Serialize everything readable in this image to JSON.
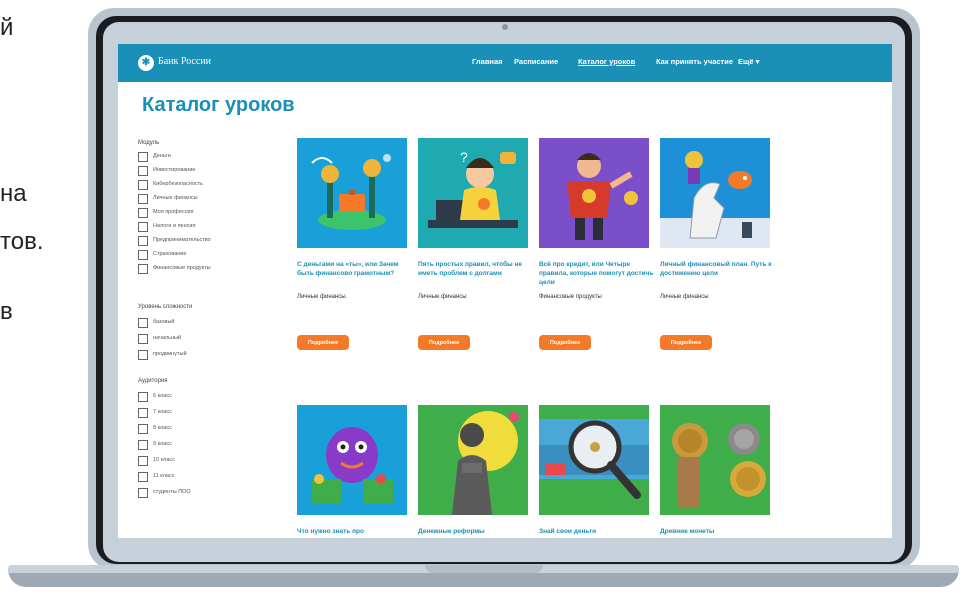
{
  "slide_fragments": [
    "й",
    "на",
    "тов.",
    "в"
  ],
  "brand": {
    "name": "Банк России"
  },
  "nav": {
    "items": [
      {
        "label": "Главная"
      },
      {
        "label": "Расписание"
      },
      {
        "label": "Каталог уроков",
        "active": true
      },
      {
        "label": "Как принять участие"
      },
      {
        "label": "Ещё ▾"
      }
    ]
  },
  "page": {
    "title": "Каталог уроков"
  },
  "filters": {
    "module": {
      "title": "Модуль",
      "options": [
        "Деньги",
        "Инвестирование",
        "Кибербезопасность",
        "Личные финансы",
        "Моя профессия",
        "Налоги и пенсия",
        "Предпринимательство",
        "Страхование",
        "Финансовые продукты"
      ]
    },
    "level": {
      "title": "Уровень сложности",
      "options": [
        "базовый",
        "начальный",
        "продвинутый"
      ]
    },
    "audience": {
      "title": "Аудитория",
      "options": [
        "6 класс",
        "7 класс",
        "8 класс",
        "9 класс",
        "10 класс",
        "11 класс",
        "студенты ПОО"
      ]
    }
  },
  "cards": [
    {
      "title": "С деньгами на «ты», или Зачем быть финансово грамотным?",
      "tag": "Личные финансы.",
      "button": "Подробнее",
      "bg": "#1aa0d8",
      "icon": "money-plant-illustration"
    },
    {
      "title": "Пять простых правил, чтобы не иметь проблем с долгами",
      "tag": "Личные финансы",
      "button": "Подробнее",
      "bg": "#1fa9b0",
      "icon": "boy-laptop-illustration"
    },
    {
      "title": "Всё про кредит, или Четыре правила, которые помогут достичь цели",
      "tag": "Финансовые продукты",
      "button": "Подробнее",
      "bg": "#7b4fc9",
      "icon": "superhero-illustration"
    },
    {
      "title": "Личный финансовый план. Путь к достижению цели",
      "tag": "Личные финансы",
      "button": "Подробнее",
      "bg": "#1e90d8",
      "icon": "chess-horse-illustration"
    },
    {
      "title": "Что нужно знать про",
      "tag": "",
      "button": "",
      "bg": "#1aa0d8",
      "icon": "purple-monster-illustration"
    },
    {
      "title": "Денежные реформы",
      "tag": "",
      "button": "",
      "bg": "#3fae4a",
      "icon": "statue-illustration"
    },
    {
      "title": "Знай свои деньги",
      "tag": "",
      "button": "",
      "bg": "#3fae4a",
      "icon": "magnifier-banknote-illustration"
    },
    {
      "title": "Древние монеты",
      "tag": "",
      "button": "",
      "bg": "#3fae4a",
      "icon": "ancient-coins-illustration"
    }
  ]
}
